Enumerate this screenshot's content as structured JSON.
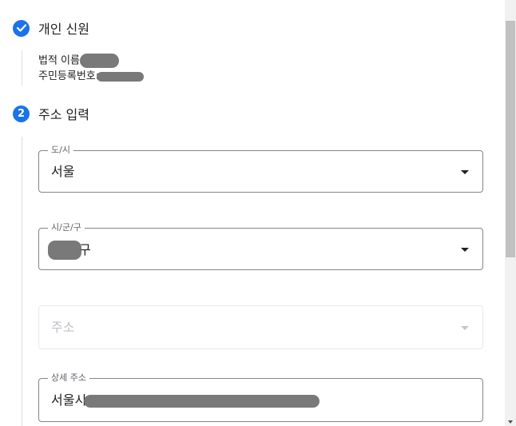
{
  "step1": {
    "title": "개인 신원",
    "status_icon": "check-icon",
    "legal_name_label": "법적 이름:",
    "resident_number_label": "주민등록번호:"
  },
  "step2": {
    "number": "2",
    "title": "주소 입력"
  },
  "fields": {
    "city": {
      "label": "도/시",
      "value": "서울"
    },
    "district": {
      "label": "시/군/구",
      "value_suffix": "구"
    },
    "address": {
      "placeholder": "주소"
    },
    "detail": {
      "label": "상세 주소",
      "value_prefix": "서울시"
    }
  },
  "colors": {
    "accent": "#1a73e8",
    "border": "#80868b",
    "disabled_text": "#bdc1c6"
  }
}
